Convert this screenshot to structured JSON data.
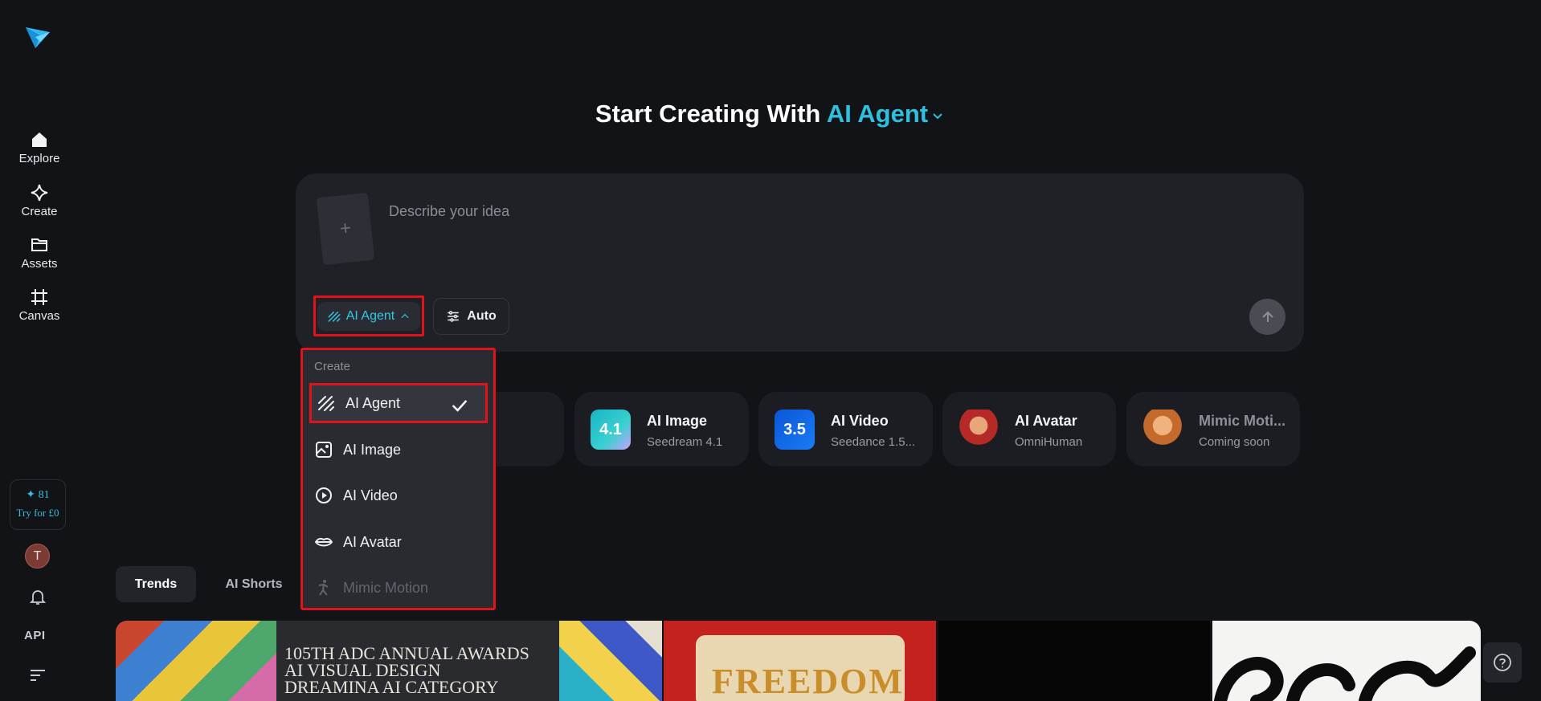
{
  "sidebar": {
    "items": [
      {
        "label": "Explore",
        "icon": "home-icon"
      },
      {
        "label": "Create",
        "icon": "diamond-icon"
      },
      {
        "label": "Assets",
        "icon": "folder-icon"
      },
      {
        "label": "Canvas",
        "icon": "crop-icon"
      }
    ],
    "credits": {
      "count": "✦ 81",
      "offer": "Try for £0"
    },
    "avatar_initial": "T",
    "api_label": "API"
  },
  "header": {
    "title_prefix": "Start Creating With",
    "title_accent": "AI Agent"
  },
  "prompt": {
    "placeholder": "Describe your idea",
    "upload_symbol": "+",
    "mode_label": "AI Agent",
    "auto_label": "Auto"
  },
  "cards": [
    {
      "title": "AI Image",
      "subtitle": "Seedream 4.1",
      "badge": "4.1"
    },
    {
      "title": "AI Video",
      "subtitle": "Seedance 1.5...",
      "badge": "3.5"
    },
    {
      "title": "AI Avatar",
      "subtitle": "OmniHuman"
    },
    {
      "title": "Mimic Moti...",
      "subtitle": "Coming soon"
    }
  ],
  "dropdown": {
    "header": "Create",
    "items": [
      {
        "label": "AI Agent",
        "selected": true
      },
      {
        "label": "AI Image"
      },
      {
        "label": "AI Video"
      },
      {
        "label": "AI Avatar"
      },
      {
        "label": "Mimic Motion",
        "disabled": true
      }
    ]
  },
  "tabs": [
    {
      "label": "Trends",
      "active": true
    },
    {
      "label": "AI Shorts"
    }
  ],
  "gallery": {
    "banner_lines": [
      "105TH ADC ANNUAL AWARDS",
      "AI VISUAL DESIGN",
      "DREAMINA AI CATEGORY"
    ],
    "scroll_text": "FREEDOM"
  },
  "colors": {
    "accent": "#2dc0df",
    "highlight": "#e0131c",
    "background": "#121316"
  }
}
